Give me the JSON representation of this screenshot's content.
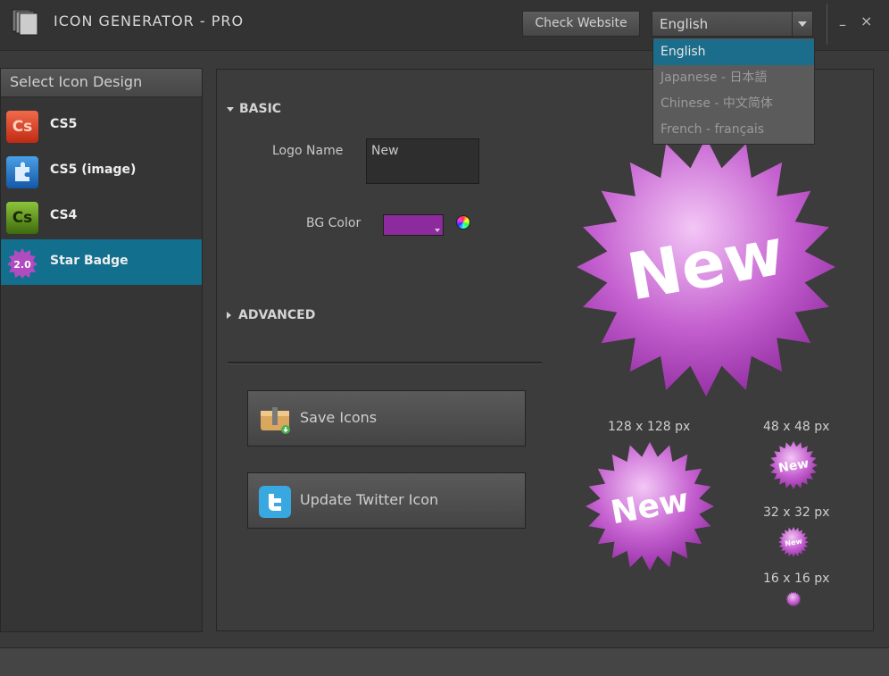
{
  "app": {
    "title": "ICON GENERATOR - PRO",
    "check_website_label": "Check Website",
    "minimize_label": "–",
    "close_label": "×"
  },
  "language": {
    "selected": "English",
    "options": [
      "English",
      "Japanese - 日本語",
      "Chinese - 中文简体",
      "French - français"
    ]
  },
  "sidebar": {
    "title": "Select Icon Design",
    "items": [
      {
        "label": "CS5",
        "icon": "cs5-icon",
        "icon_text": "Cs"
      },
      {
        "label": "CS5 (image)",
        "icon": "puzzle-icon"
      },
      {
        "label": "CS4",
        "icon": "cs4-icon",
        "icon_text": "Cs"
      },
      {
        "label": "Star Badge",
        "icon": "star-badge-icon",
        "icon_text": "2.0",
        "selected": true
      }
    ]
  },
  "basic": {
    "heading": "BASIC",
    "logo_name_label": "Logo Name",
    "logo_name_value": "New",
    "bg_color_label": "BG Color",
    "bg_color": "#8d2b9e"
  },
  "advanced": {
    "heading": "ADVANCED"
  },
  "actions": {
    "save_label": "Save Icons",
    "twitter_label": "Update Twitter Icon"
  },
  "preview": {
    "badge_text": "New",
    "sizes": [
      "128 x 128 px",
      "48 x 48 px",
      "32 x 32 px",
      "16 x 16 px"
    ]
  },
  "colors": {
    "accent": "#136f8e",
    "badge": "#b04cc0"
  }
}
